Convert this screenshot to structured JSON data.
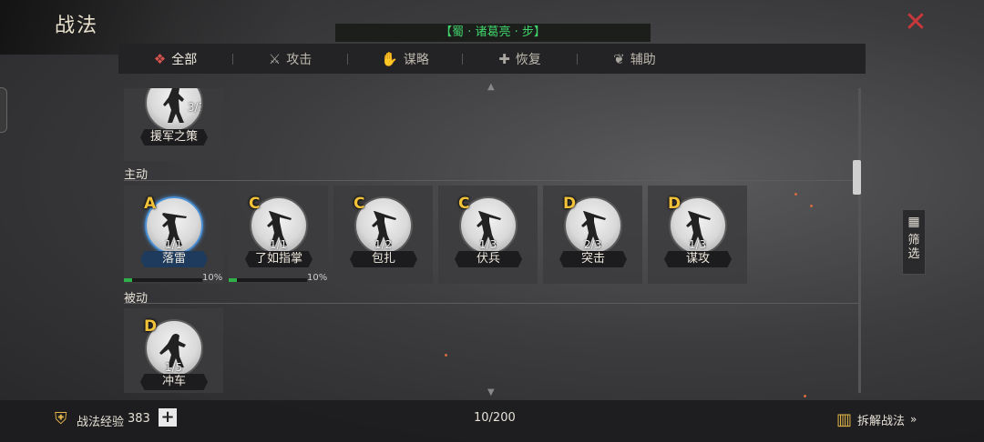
{
  "header": {
    "title": "战法",
    "subtitle": "【蜀 · 诸葛亮 · 步】",
    "close_icon": "close-icon"
  },
  "tabs": [
    {
      "label": "全部",
      "icon": "all-icon",
      "active": true
    },
    {
      "label": "攻击",
      "icon": "crossed-swords-icon",
      "active": false
    },
    {
      "label": "谋略",
      "icon": "hand-icon",
      "active": false
    },
    {
      "label": "恢复",
      "icon": "recover-icon",
      "active": false
    },
    {
      "label": "辅助",
      "icon": "bag-icon",
      "active": false
    }
  ],
  "sections": {
    "top_cards": [
      {
        "name": "援军之策",
        "count": "3/3",
        "grade": ""
      }
    ],
    "active": {
      "label": "主动",
      "cards": [
        {
          "name": "落雷",
          "count": "1/1",
          "grade": "A",
          "progress_label": "10%",
          "progress": 0.1,
          "highlight": true
        },
        {
          "name": "了如指掌",
          "count": "1/1",
          "grade": "C",
          "progress_label": "10%",
          "progress": 0.1,
          "highlight": false
        },
        {
          "name": "包扎",
          "count": "1/2",
          "grade": "C"
        },
        {
          "name": "伏兵",
          "count": "1/3",
          "grade": "C"
        },
        {
          "name": "突击",
          "count": "2/3",
          "grade": "D"
        },
        {
          "name": "谋攻",
          "count": "1/3",
          "grade": "D"
        }
      ]
    },
    "passive": {
      "label": "被动",
      "cards": [
        {
          "name": "冲车",
          "count": "1/5",
          "grade": "D"
        }
      ]
    }
  },
  "filter": {
    "label": "筛选",
    "icon": "filter-grid-icon"
  },
  "footer": {
    "exp_label": "战法经验",
    "exp_value": "383",
    "plus": "+",
    "capacity": "10/200",
    "disassemble_label": "拆解战法",
    "disassemble_arrow": "»"
  },
  "colors": {
    "subtitle": "#3fd36a",
    "close": "#c8383a",
    "grade": "#f2c23a",
    "progress": "#2fb04a"
  }
}
